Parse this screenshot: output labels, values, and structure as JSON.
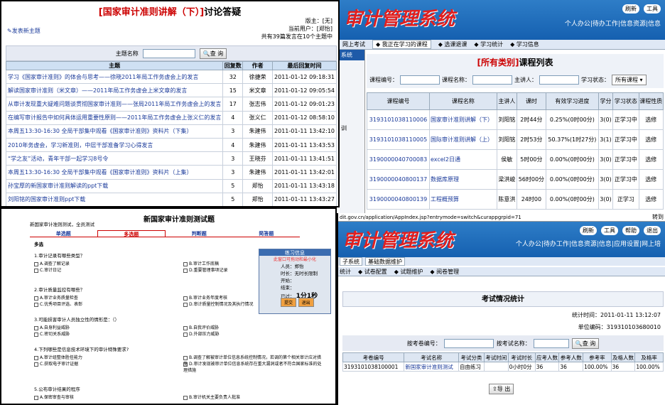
{
  "forum": {
    "title_red": "[国家审计准则讲解（下）]",
    "title_rest": "讨论答疑",
    "moderator": "版主：[无]",
    "current_user": "当前用户：[郑怡]",
    "stats": "共有39篇发言在10个主题中",
    "post_new": "发表新主题",
    "search_label": "主题名称",
    "search_button": "查 询",
    "headers": [
      "主题",
      "回复数",
      "作者",
      "最后回复时间"
    ],
    "rows": [
      [
        "学习《国家审计准则》的体会与思考——徐晓2011年局工作务虚会上的发言",
        "32",
        "徐捷荣",
        "2011-01-12 09:18:31"
      ],
      [
        "解读国家审计准则（米文章）——2011年局工作务虚会上米文章的发言",
        "15",
        "米文章",
        "2011-01-12 09:05:54"
      ],
      [
        "从审计发现重大疑难问题谈贯彻国家审计准则——张局2011年局工作务虚会上的发言",
        "17",
        "张志伟",
        "2011-01-12 09:01:23"
      ],
      [
        "在编写审计报告中如何具体运用重要性原则——2011年局工作务虚会上张义仁的发言",
        "4",
        "张义仁",
        "2011-01-12 08:58:10"
      ],
      [
        "本周五13:30-16:30 全局干部集中观看《国家审计准则》资料片（下集）",
        "3",
        "朱建伟",
        "2011-01-11 13:42:10"
      ],
      [
        "2010年务虚会，学习新准则，中层干部准备学习心得发言",
        "4",
        "朱建伟",
        "2011-01-11 13:43:53"
      ],
      [
        "“学之友”活动，青年干部一起学习8号令",
        "3",
        "王晓芬",
        "2011-01-11 13:41:51"
      ],
      [
        "本周五13:30-16:30 全局干部集中观看《国家审计准则》资料片（上集）",
        "3",
        "朱建伟",
        "2011-01-11 13:42:01"
      ],
      [
        "孙宝厚的新国家审计准则解读的ppt下载",
        "5",
        "郑怡",
        "2011-01-11 13:43:18"
      ],
      [
        "刘阳铭的国家审计准则ppt下载",
        "5",
        "郑怡",
        "2011-01-11 13:43:27"
      ]
    ]
  },
  "course": {
    "logo": "审计管理系统",
    "tools": [
      "刷新",
      "工具"
    ],
    "menu": "个人办公|待办工作|信息资源|信息",
    "tabs": [
      "网上考试",
      "我正在学习的课程",
      "选课退课",
      "学习统计",
      "学习信息"
    ],
    "side_label": "系统",
    "side_extra": "训",
    "title_red": "[所有类别]",
    "title_rest": "课程列表",
    "filter": {
      "code": "课程编号：",
      "name": "课程名称：",
      "lecturer": "主讲人：",
      "status": "学习状态：",
      "status_value": "所有课程"
    },
    "headers": [
      "课程编号",
      "课程名称",
      "主讲人",
      "课时",
      "有效学习进度",
      "学分",
      "学习状态",
      "课程性质"
    ],
    "rows": [
      [
        "3193101038110006",
        "国家审计准则讲解（下）",
        "刘阳铭",
        "2时44分",
        "0.25%(0时00分)",
        "3(0)",
        "正学习中",
        "选修"
      ],
      [
        "3193101038110005",
        "国际审计准则讲解（上）",
        "刘阳铭",
        "2时53分",
        "50.37%(1时27分)",
        "3(1)",
        "正学习中",
        "选修"
      ],
      [
        "3190000040700083",
        "excel2日通",
        "侯敏",
        "5时00分",
        "0.00%(0时00分)",
        "3(0)",
        "正学习中",
        "选修"
      ],
      [
        "3190000040800137",
        "数据库原理",
        "梁洪峻",
        "56时00分",
        "0.00%(0时00分)",
        "3(0)",
        "正学习中",
        "选修"
      ],
      [
        "3190000040800139",
        "工程概预算",
        "陈意洪",
        "24时00",
        "0.00%(0时00分)",
        "3(0)",
        "正学习",
        "选修"
      ]
    ]
  },
  "exam": {
    "title": "新国家审计准则测试题",
    "desc": "新国家审计准则测试，全员测试",
    "tabs": [
      "单选题",
      "多选题",
      "判断题",
      "简答题"
    ],
    "section": "多选",
    "questions": [
      {
        "q": "1.审计记录有哪些类型？",
        "opts": [
          "A.调查了解记录",
          "B.审计工作底稿",
          "C.审计日记",
          "D.重要管理事项记录"
        ]
      },
      {
        "q": "2.审计质量监控有哪些？",
        "opts": [
          "A.审计业务质量检查",
          "B.审计业务年度考核",
          "C.优秀项目评选、表彰",
          "D.审计质量控制情况及其执行情况"
        ]
      },
      {
        "q": "3.可能损害审计人员独立性的情形是：（）",
        "opts": [
          "A.自身利益威胁",
          "B.自我评价威胁",
          "C.密切关系威胁",
          "D.外部压力威胁"
        ]
      },
      {
        "q": "4.下列哪些是信息技术环境下的审计特殊要求?",
        "opts": [
          "A.审计组整体胜任能力",
          "B.调查了解被审计单位信息系统控制情况，若调的第个相关审计应对措施",
          "C.获取电子审计证据",
          "D.审计发现被审计单位信息系统存在重大漏洞或者不符合国家标准的处理措施"
        ]
      },
      {
        "q": "5.公布审计结果的程序",
        "opts": [
          "A.保密审查与审核",
          "B.审计机关主要负责人批准"
        ]
      }
    ],
    "popup": {
      "title": "练习信息",
      "sub": "此窗口可拖动和最小化",
      "rows": [
        "人员：郑怡",
        "时长：无时长限制",
        "开始：",
        "结束：",
        "已过："
      ],
      "elapsed": "1分1秒",
      "buttons": [
        "提交",
        "退出"
      ]
    }
  },
  "stats": {
    "url": "dit.gov.cn/application/AppIndex.jsp?entrymode=switch&curappgrpid=71",
    "go": "转到",
    "logo": "审计管理系统",
    "tools": [
      "刷新",
      "工具",
      "帮助",
      "退出"
    ],
    "menu": "个人办公|待办工作|信息资源|信息|应用设置|网上培",
    "tabs_top": [
      "子系统",
      "基础数据维护"
    ],
    "tabs": [
      "统计",
      "试卷配置",
      "试题维护",
      "阅卷管理"
    ],
    "title": "考试情况统计",
    "stat_time": "统计时间：2011-01-11 13:12:07",
    "unit_code": "单位编码：319310103680010",
    "search_code": "按考卷编号：",
    "search_name": "按考试名称：",
    "search_button": "查 询",
    "headers": [
      "考卷编号",
      "考试名称",
      "考试分类",
      "考试时间",
      "考试时长",
      "应考人数",
      "参考人数",
      "参考率",
      "及格人数",
      "及格率"
    ],
    "row": [
      "3193101038100001",
      "新国家审计准则测试",
      "自由练习",
      "",
      "0小时0分",
      "36",
      "36",
      "100.00%",
      "36",
      "100.00%"
    ],
    "export": "导 出"
  }
}
